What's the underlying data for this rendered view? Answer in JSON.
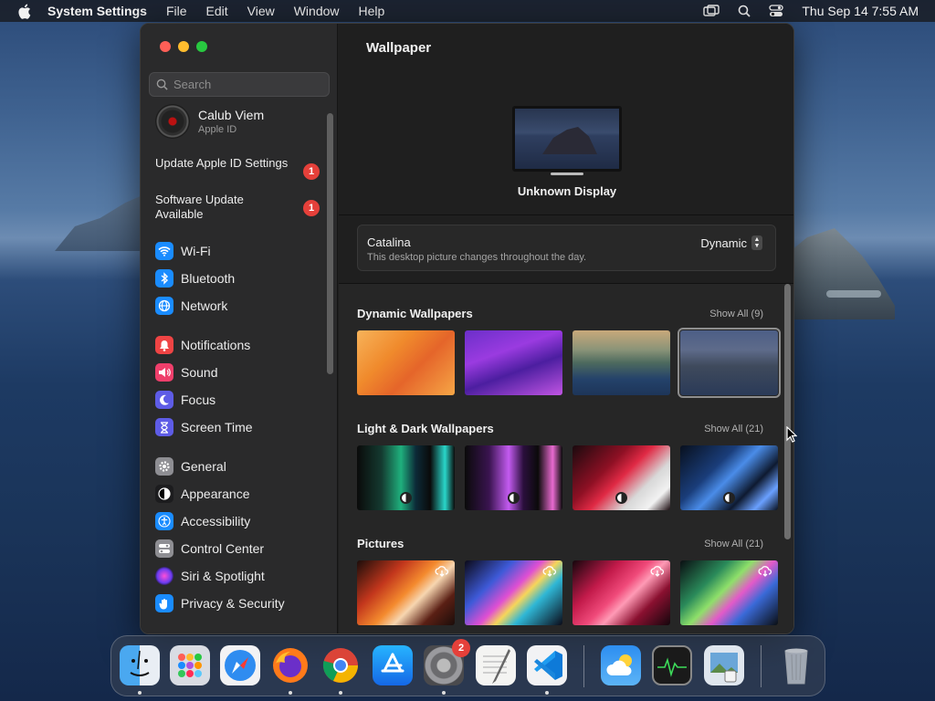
{
  "menubar": {
    "app_name": "System Settings",
    "menus": [
      "File",
      "Edit",
      "View",
      "Window",
      "Help"
    ],
    "datetime": "Thu Sep 14  7:55 AM",
    "icons": [
      "apple-icon",
      "screen-mirroring-icon",
      "spotlight-search-icon",
      "control-center-icon"
    ]
  },
  "sidebar": {
    "search_placeholder": "Search",
    "profile": {
      "name": "Calub Viem",
      "sub": "Apple ID"
    },
    "alerts": [
      {
        "label": "Update Apple ID Settings",
        "badge": "1"
      },
      {
        "label": "Software Update Available",
        "badge": "1"
      }
    ],
    "groups": [
      [
        {
          "label": "Wi-Fi",
          "icon": "wifi-icon",
          "color": "#1a8cff"
        },
        {
          "label": "Bluetooth",
          "icon": "bluetooth-icon",
          "color": "#1a8cff"
        },
        {
          "label": "Network",
          "icon": "globe-icon",
          "color": "#1a8cff"
        }
      ],
      [
        {
          "label": "Notifications",
          "icon": "bell-icon",
          "color": "#ef4444"
        },
        {
          "label": "Sound",
          "icon": "speaker-icon",
          "color": "#ef3f6b"
        },
        {
          "label": "Focus",
          "icon": "moon-icon",
          "color": "#5e5ce6"
        },
        {
          "label": "Screen Time",
          "icon": "hourglass-icon",
          "color": "#5e5ce6"
        }
      ],
      [
        {
          "label": "General",
          "icon": "gear-icon",
          "color": "#8e8e93"
        },
        {
          "label": "Appearance",
          "icon": "appearance-icon",
          "color": "#1c1c1e"
        },
        {
          "label": "Accessibility",
          "icon": "accessibility-icon",
          "color": "#1a8cff"
        },
        {
          "label": "Control Center",
          "icon": "control-center-icon",
          "color": "#8e8e93"
        },
        {
          "label": "Siri & Spotlight",
          "icon": "siri-icon",
          "color": "#b14fd8"
        },
        {
          "label": "Privacy & Security",
          "icon": "hand-icon",
          "color": "#1a8cff"
        }
      ]
    ]
  },
  "main": {
    "title": "Wallpaper",
    "display_name": "Unknown Display",
    "current": {
      "name": "Catalina",
      "description": "This desktop picture changes throughout the day.",
      "mode": "Dynamic"
    },
    "sections": [
      {
        "title": "Dynamic Wallpapers",
        "show_all": "Show All (9)"
      },
      {
        "title": "Light & Dark Wallpapers",
        "show_all": "Show All (21)"
      },
      {
        "title": "Pictures",
        "show_all": "Show All (21)"
      }
    ]
  },
  "dock": {
    "apps": [
      "Finder",
      "Launchpad",
      "Safari",
      "Firefox",
      "Chrome",
      "App Store",
      "System Settings",
      "TextEdit",
      "Visual Studio Code",
      "Weather",
      "Activity Monitor",
      "Preview",
      "Trash"
    ],
    "settings_badge": "2"
  }
}
